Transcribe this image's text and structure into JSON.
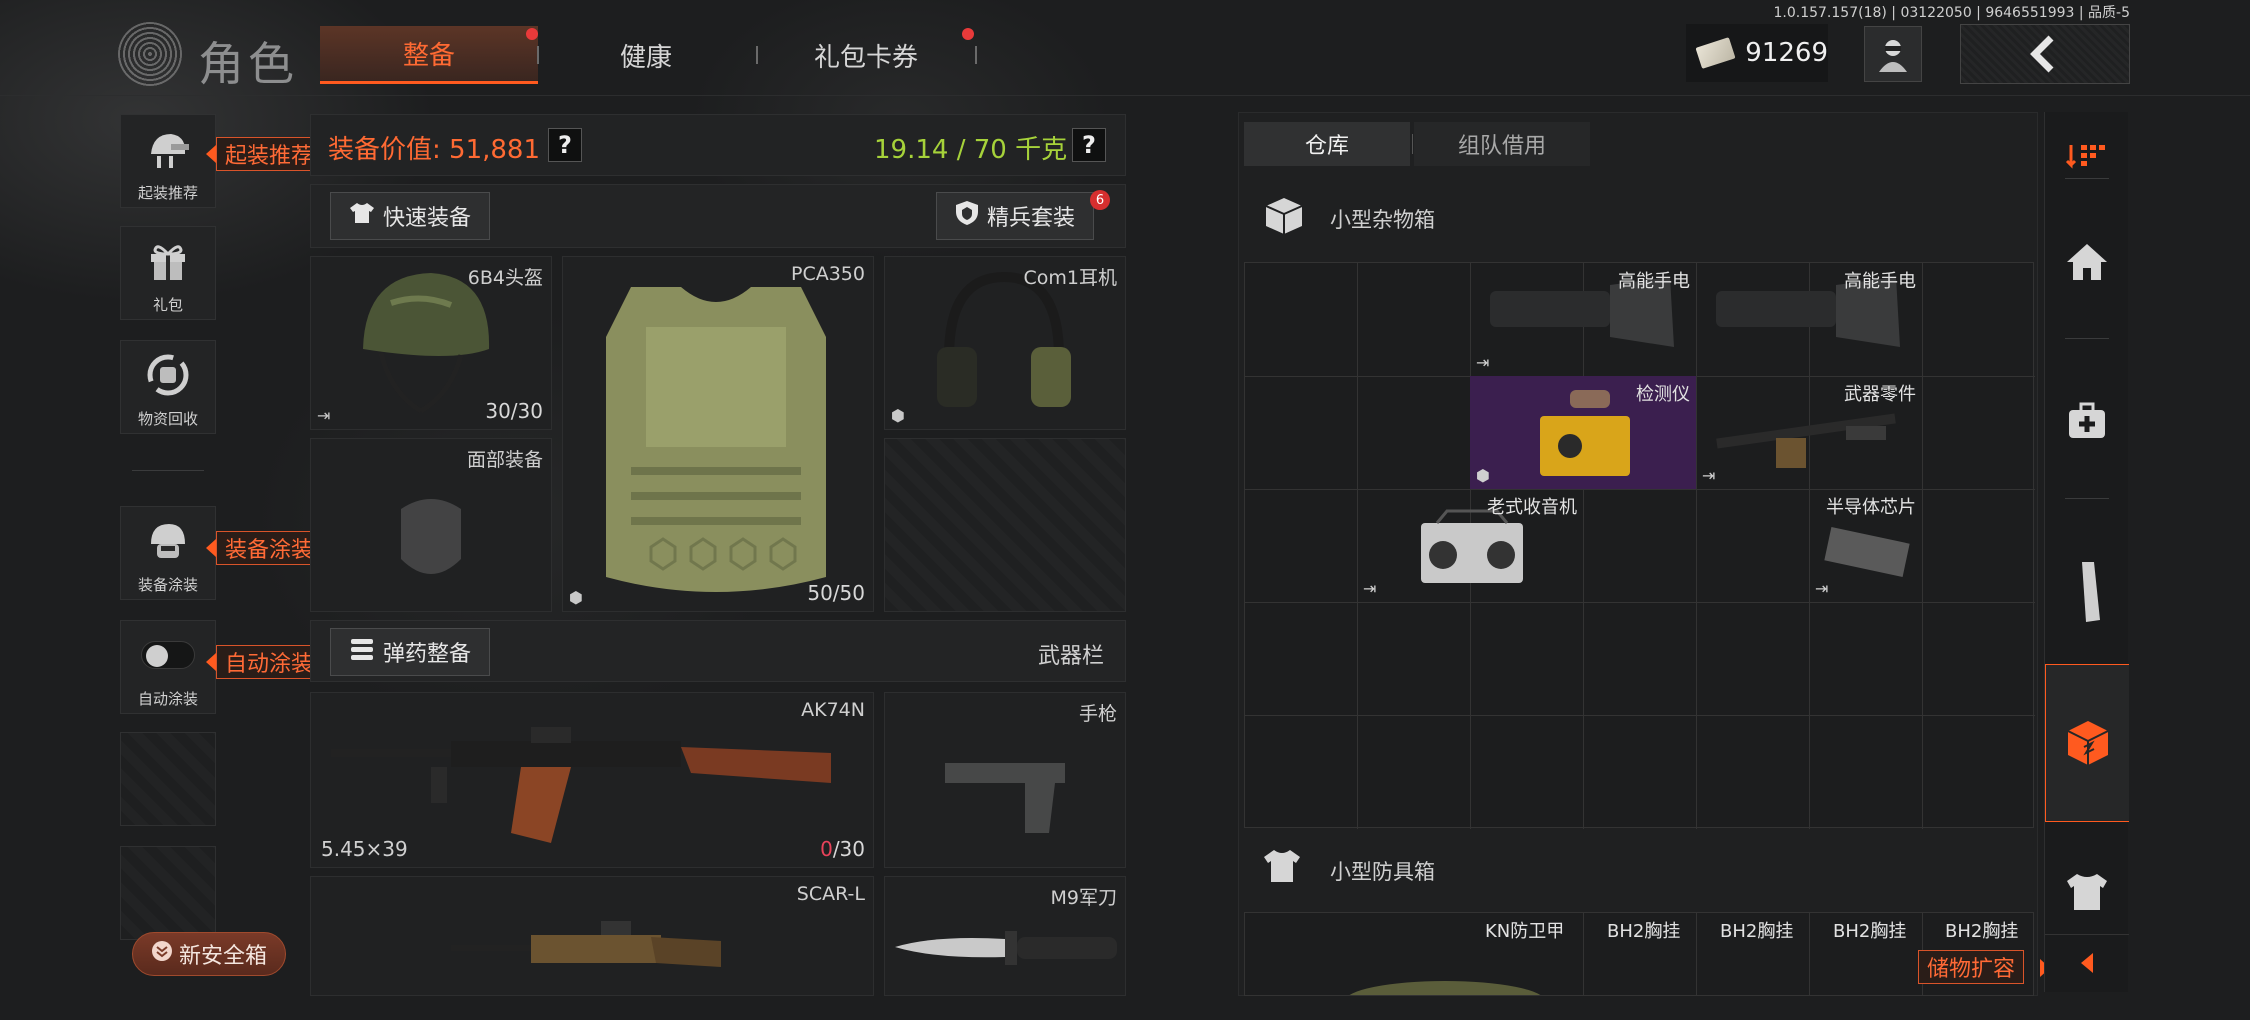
{
  "header": {
    "title": "角色",
    "tabs": [
      {
        "label": "整备",
        "active": true,
        "has_dot": true
      },
      {
        "label": "健康",
        "active": false,
        "has_dot": false
      },
      {
        "label": "礼包卡券",
        "active": false,
        "has_dot": true
      }
    ],
    "version": "1.0.157.157(18) | 03122050 | 9646551993 | 品质-5",
    "currency": {
      "icon": "cash-icon",
      "value": "91269"
    },
    "back_icon": "chevron-left-icon"
  },
  "sidebar": {
    "items": [
      {
        "label": "起装推荐",
        "icon": "loadout-recommend-icon",
        "callout": "起装推荐"
      },
      {
        "label": "礼包",
        "icon": "gift-icon",
        "callout": ""
      },
      {
        "label": "物资回收",
        "icon": "recycle-icon",
        "callout": ""
      },
      {
        "label": "装备涂装",
        "icon": "helmet-paint-icon",
        "callout": "装备涂装"
      },
      {
        "label": "自动涂装",
        "icon": "toggle-icon",
        "callout": "自动涂装",
        "toggle_on": false
      }
    ],
    "safe_box_button": "新安全箱"
  },
  "loadout": {
    "value_label": "装备价值: 51,881",
    "weight_label": "19.14 / 70 千克",
    "quick_equip": "快速装备",
    "elite_set": "精兵套装",
    "elite_badge": "6",
    "slots": {
      "helmet": {
        "name": "6B4头盔",
        "durability": "30/30"
      },
      "armor": {
        "name": "PCA350",
        "durability": "50/50"
      },
      "headset": {
        "name": "Com1耳机"
      },
      "face": {
        "name": "面部装备"
      }
    },
    "ammo_button": "弹药整备",
    "weapon_bar": "武器栏",
    "weapons": {
      "primary": {
        "name": "AK74N",
        "caliber": "5.45×39",
        "ammo_current": "0",
        "ammo_max": "/30"
      },
      "pistol": {
        "name": "手枪"
      },
      "secondary": {
        "name": "SCAR-L"
      },
      "melee": {
        "name": "M9军刀"
      }
    }
  },
  "storage": {
    "tabs": [
      "仓库",
      "组队借用"
    ],
    "containers": [
      {
        "name": "小型杂物箱",
        "items": [
          "高能手电",
          "高能手电",
          "检测仪",
          "武器零件",
          "老式收音机",
          "半导体芯片"
        ]
      },
      {
        "name": "小型防具箱",
        "items": [
          "KN防卫甲",
          "BH2胸挂",
          "BH2胸挂",
          "BH2胸挂",
          "BH2胸挂"
        ]
      }
    ],
    "expand_callout": "储物扩容"
  },
  "rail": {
    "icons": [
      "sort-icon",
      "home-icon",
      "medkit-icon",
      "magazine-icon",
      "container-icon",
      "armor-icon",
      "chevron-left-icon"
    ]
  },
  "colors": {
    "accent": "#ff5a1f",
    "weight_green": "#a6d23a",
    "detector_bg": "#3b1f4f",
    "ammo_red": "#e8425a"
  }
}
